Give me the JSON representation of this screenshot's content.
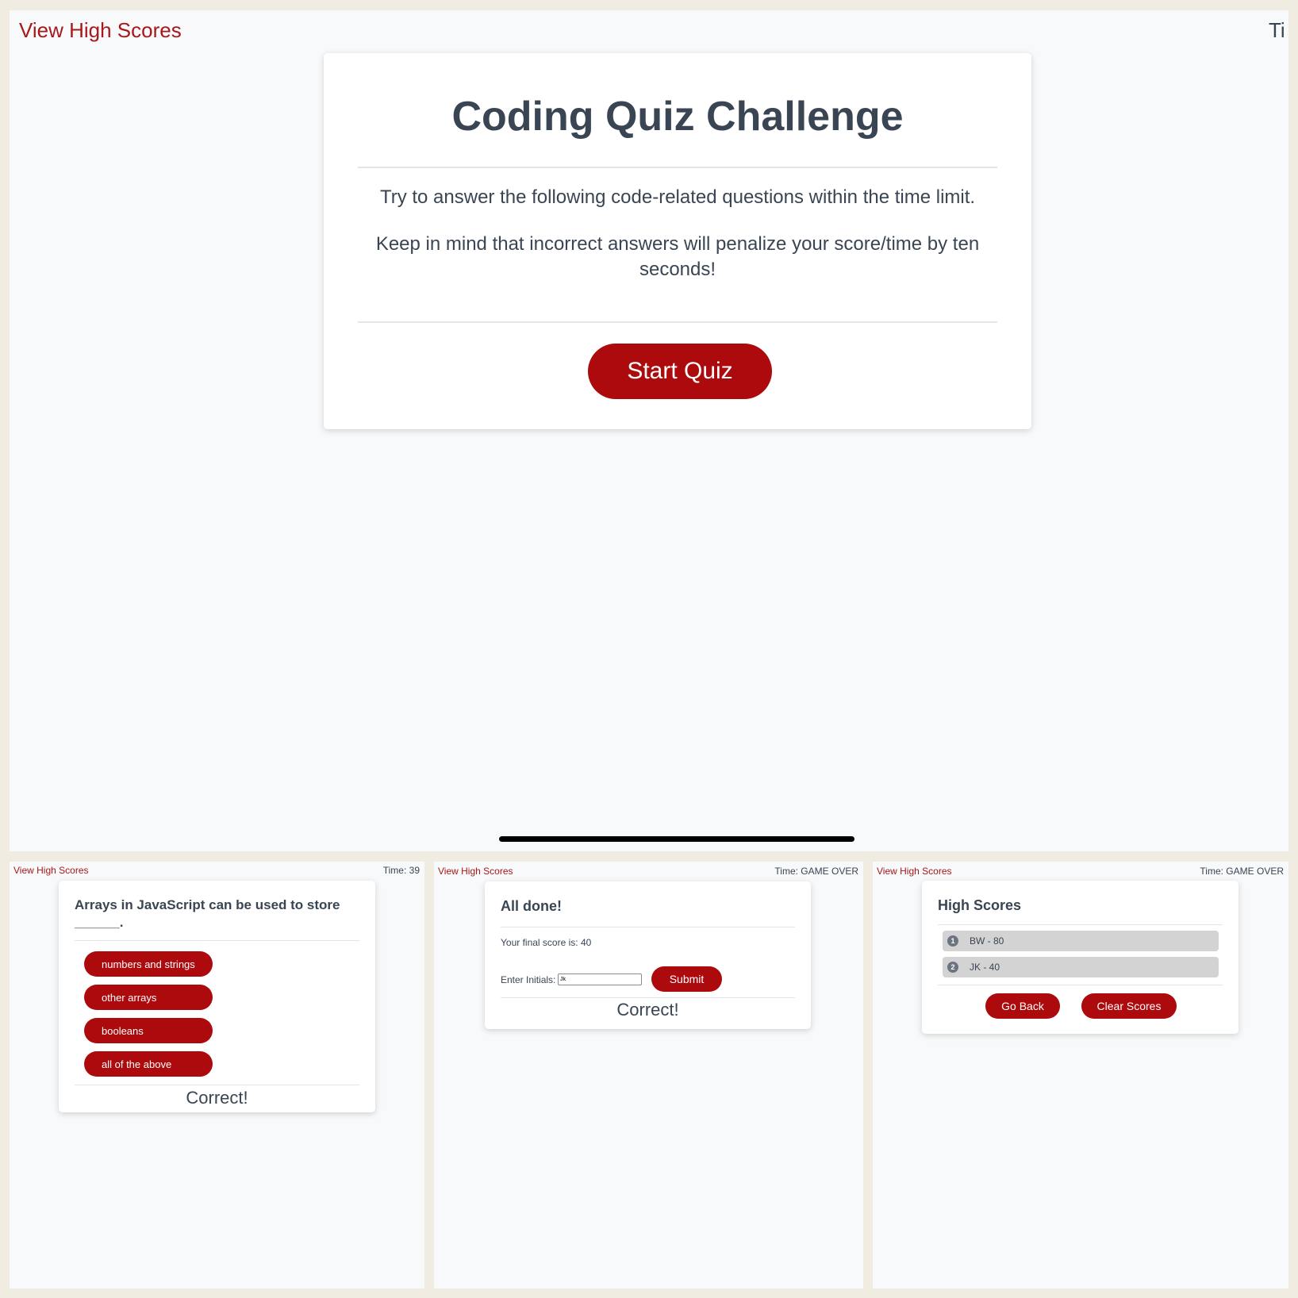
{
  "main": {
    "view_high_scores": "View High Scores",
    "timer_partial": "Ti",
    "title": "Coding Quiz Challenge",
    "intro_1": "Try to answer the following code-related questions within the time limit.",
    "intro_2": "Keep in mind that incorrect answers will penalize your score/time by ten seconds!",
    "start_button": "Start Quiz"
  },
  "question_screen": {
    "view_high_scores": "View High Scores",
    "timer": "Time: 39",
    "question": "Arrays in JavaScript can be used to store ______.",
    "answers": [
      "numbers and strings",
      "other arrays",
      "booleans",
      "all of the above"
    ],
    "feedback": "Correct!"
  },
  "done_screen": {
    "view_high_scores": "View High Scores",
    "timer": "Time: GAME OVER",
    "title": "All done!",
    "final_score": "Your final score is: 40",
    "initials_label": "Enter Initials:",
    "initials_value": "Jk",
    "submit_button": "Submit",
    "feedback": "Correct!"
  },
  "scores_screen": {
    "view_high_scores": "View High Scores",
    "timer": "Time: GAME OVER",
    "title": "High Scores",
    "entries": [
      {
        "rank": "1",
        "text": "BW - 80"
      },
      {
        "rank": "2",
        "text": "JK - 40"
      }
    ],
    "go_back_button": "Go Back",
    "clear_button": "Clear Scores"
  },
  "colors": {
    "accent": "#ac0a0d",
    "link": "#a8171a",
    "text": "#3a4553",
    "frame": "#f1ece2",
    "page": "#f7f9fa",
    "score_row": "#d3d3d3"
  }
}
